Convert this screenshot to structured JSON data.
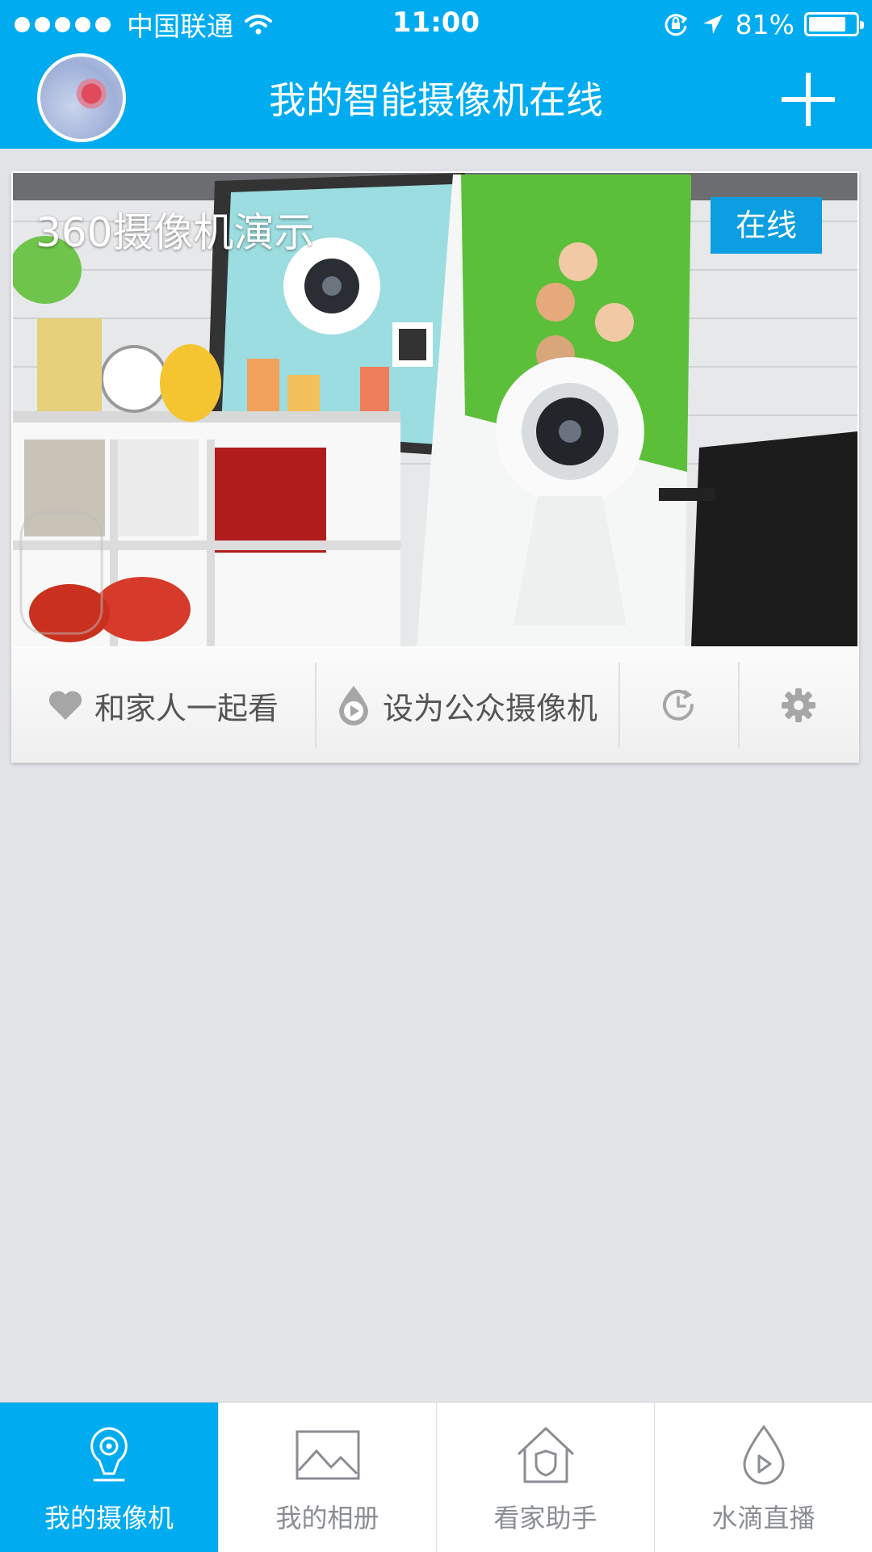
{
  "status_bar": {
    "carrier": "中国联通",
    "time": "11:00",
    "battery_percent": "81%",
    "battery_level": 0.81,
    "signal_bars": 5
  },
  "nav": {
    "title": "我的智能摄像机在线",
    "add_icon": "plus-icon",
    "avatar_icon": "user-avatar"
  },
  "camera": {
    "name": "360摄像机演示",
    "status": "在线"
  },
  "actions": [
    {
      "label": "和家人一起看",
      "icon": "heart-icon"
    },
    {
      "label": "设为公众摄像机",
      "icon": "play-drop-icon"
    },
    {
      "label": "",
      "icon": "history-clock-icon"
    },
    {
      "label": "",
      "icon": "gear-icon"
    }
  ],
  "tabs": [
    {
      "label": "我的摄像机",
      "icon": "camera-pin-icon",
      "active": true
    },
    {
      "label": "我的相册",
      "icon": "picture-icon",
      "active": false
    },
    {
      "label": "看家助手",
      "icon": "house-shield-icon",
      "active": false
    },
    {
      "label": "水滴直播",
      "icon": "drop-play-icon",
      "active": false
    }
  ],
  "colors": {
    "primary": "#00acef",
    "badge": "#0c9ee0",
    "background": "#e2e4e8",
    "tab_inactive": "#8a8d92"
  }
}
